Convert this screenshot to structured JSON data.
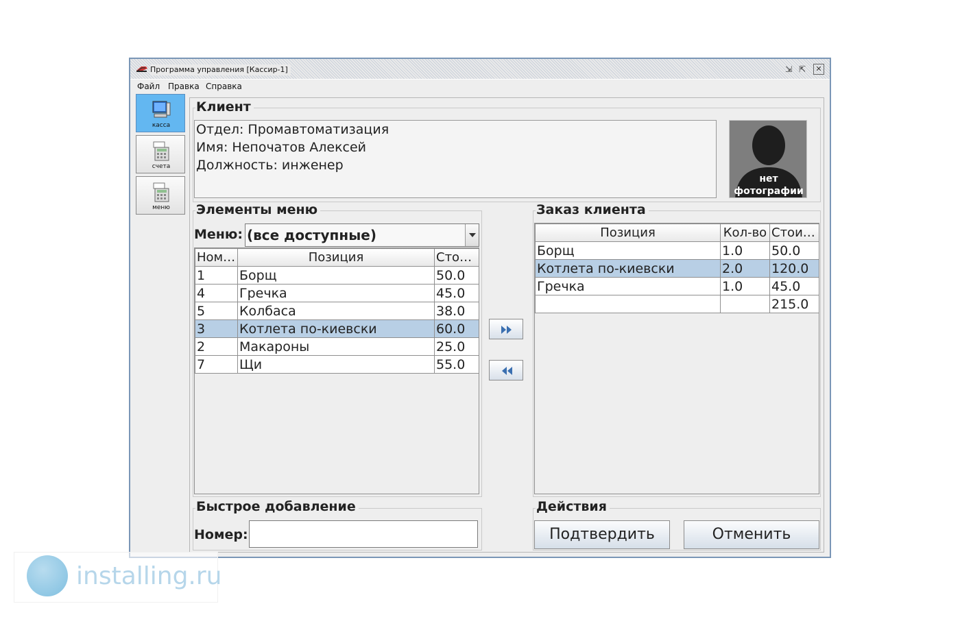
{
  "window": {
    "title": "Программа управления [Кассир-1]",
    "minimize_glyph": "⇲",
    "maximize_glyph": "⇱",
    "close_glyph": "✕"
  },
  "menu": {
    "items": [
      "Файл",
      "Правка",
      "Справка"
    ]
  },
  "sidebar": {
    "items": [
      {
        "label": "касса",
        "icon": "computer-icon",
        "active": true
      },
      {
        "label": "счета",
        "icon": "calculator-icon",
        "active": false
      },
      {
        "label": "меню",
        "icon": "calculator-icon",
        "active": false
      }
    ]
  },
  "client": {
    "section_title": "Клиент",
    "department": "Отдел: Промавтоматизация",
    "name": "Имя: Непочатов Алексей",
    "position": "Должность: инженер",
    "photo_placeholder_line1": "нет",
    "photo_placeholder_line2": "фотографии"
  },
  "menu_panel": {
    "section_title": "Элементы меню",
    "menu_label": "Меню:",
    "menu_selected": "(все доступные)",
    "columns": [
      "Номер",
      "Позиция",
      "Стоимость"
    ],
    "rows": [
      {
        "num": "1",
        "item": "Борщ",
        "price": "50.0"
      },
      {
        "num": "4",
        "item": "Гречка",
        "price": "45.0"
      },
      {
        "num": "5",
        "item": "Колбаса",
        "price": "38.0"
      },
      {
        "num": "3",
        "item": "Котлета по-киевски",
        "price": "60.0"
      },
      {
        "num": "2",
        "item": "Макароны",
        "price": "25.0"
      },
      {
        "num": "7",
        "item": "Щи",
        "price": "55.0"
      }
    ],
    "selected_row": 3
  },
  "order": {
    "section_title": "Заказ клиента",
    "columns": [
      "Позиция",
      "Кол-во",
      "Стоимость"
    ],
    "rows": [
      {
        "item": "Борщ",
        "qty": "1.0",
        "cost": "50.0"
      },
      {
        "item": "Котлета по-киевски",
        "qty": "2.0",
        "cost": "120.0"
      },
      {
        "item": "Гречка",
        "qty": "1.0",
        "cost": "45.0"
      },
      {
        "item": "",
        "qty": "",
        "cost": "215.0"
      }
    ],
    "selected_row": 1
  },
  "quick_add": {
    "section_title": "Быстрое добавление",
    "number_label": "Номер:",
    "number_value": ""
  },
  "actions": {
    "section_title": "Действия",
    "confirm_label": "Подтвердить",
    "cancel_label": "Отменить"
  },
  "watermark": {
    "text": "installing.ru"
  },
  "colors": {
    "selection": "#b8cfe5",
    "active_tab": "#63b7f1",
    "arrow": "#3a6fb0"
  }
}
